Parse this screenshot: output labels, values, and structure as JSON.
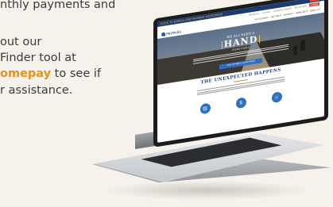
{
  "side_text": {
    "line1": "nthly payments and",
    "line2": "out our",
    "line3": "Finder tool at",
    "line4_accent": "omepay",
    "line4_rest": " to see if",
    "line5": "r assistance."
  },
  "website": {
    "alert_text": "CLICK TO ENROLL FOR PAYMENT ASSISTANCE",
    "utility_links": [
      "Resources",
      "Contact",
      "Customer Support",
      "My Account",
      "LOGIN"
    ],
    "logo_text": "PEOPLES",
    "nav_items": [
      "MY ACCOUNT",
      "GET HELP",
      "SUPPORT",
      "MORE INFO",
      "ABOUT US"
    ],
    "hero": {
      "kicker": "WE ALL NEED A",
      "headline": "HAND",
      "subhead": "SOMETIMES",
      "cta": "FIND PAYMENT ASSISTANCE"
    },
    "section": {
      "title": "THE UNEXPECTED HAPPENS"
    },
    "feature_icons": [
      "document-icon",
      "hand-dollar-icon",
      "people-icon"
    ]
  },
  "colors": {
    "accent": "#e8901c",
    "brand_blue": "#1d3b73",
    "button_blue": "#2f6fc2",
    "alert_bar": "#1d3b73",
    "login_red": "#d84d35"
  }
}
